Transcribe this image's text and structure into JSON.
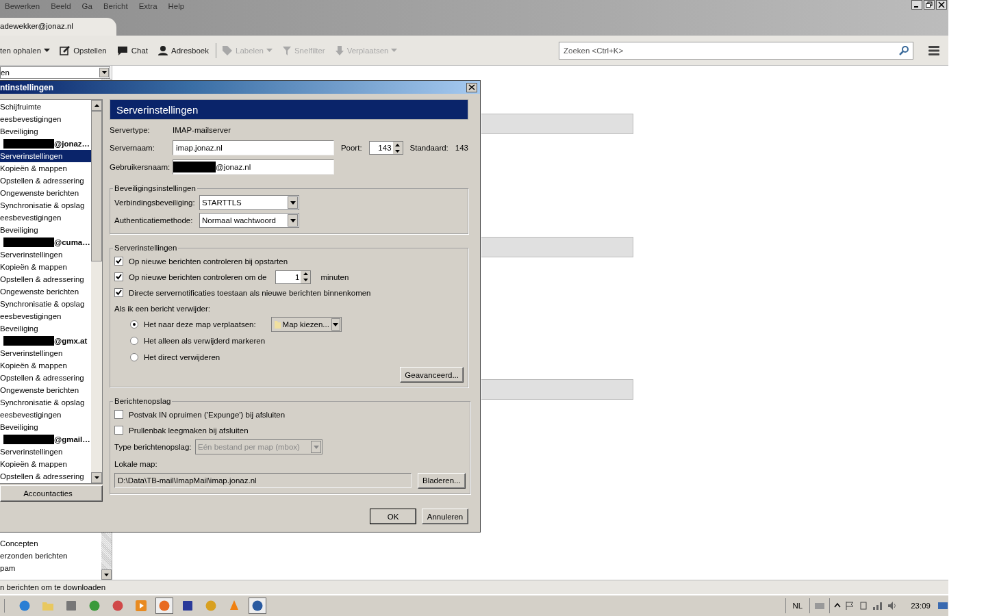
{
  "menu_bar": [
    "Bewerken",
    "Beeld",
    "Ga",
    "Bericht",
    "Extra",
    "Help"
  ],
  "tab": {
    "label": "adewekker@jonaz.nl",
    "selected": true
  },
  "toolbar": [
    {
      "label": "ten ophalen",
      "kind": "none",
      "dropdown": true,
      "disabled": false
    },
    {
      "label": "Opstellen",
      "kind": "pencil",
      "dropdown": false,
      "disabled": false
    },
    {
      "label": "Chat",
      "kind": "bubble",
      "dropdown": false,
      "disabled": false
    },
    {
      "label": "Adresboek",
      "kind": "person",
      "dropdown": false,
      "disabled": false
    },
    {
      "label": "Labelen",
      "kind": "tag",
      "dropdown": true,
      "disabled": true
    },
    {
      "label": "Snelfilter",
      "kind": "funnel",
      "dropdown": false,
      "disabled": true
    },
    {
      "label": "Verplaatsen",
      "kind": "arrow",
      "dropdown": true,
      "disabled": true
    }
  ],
  "search": {
    "placeholder": "Zoeken <Ctrl+K>"
  },
  "folder_pane": {
    "selector": "en",
    "folders": [
      "Concepten",
      "erzonden berichten",
      "pam"
    ]
  },
  "dialog": {
    "title": "ntinstellingen",
    "tree": [
      {
        "label": "Schijfruimte",
        "selected": false
      },
      {
        "label": "eesbevestigingen",
        "selected": false
      },
      {
        "label": "Beveiliging",
        "selected": false
      },
      {
        "label": "@jonaz…",
        "redacted": true,
        "selected": false,
        "children": [
          {
            "label": "Serverinstellingen",
            "selected": true
          },
          {
            "label": "Kopieën & mappen",
            "selected": false
          },
          {
            "label": "Opstellen & adressering",
            "selected": false
          },
          {
            "label": "Ongewenste berichten",
            "selected": false
          },
          {
            "label": "Synchronisatie & opslag",
            "selected": false
          },
          {
            "label": "eesbevestigingen",
            "selected": false
          },
          {
            "label": "Beveiliging",
            "selected": false
          }
        ]
      },
      {
        "label": "@cuma…",
        "redacted": true,
        "selected": false,
        "children": [
          {
            "label": "Serverinstellingen",
            "selected": false
          },
          {
            "label": "Kopieën & mappen",
            "selected": false
          },
          {
            "label": "Opstellen & adressering",
            "selected": false
          },
          {
            "label": "Ongewenste berichten",
            "selected": false
          },
          {
            "label": "Synchronisatie & opslag",
            "selected": false
          },
          {
            "label": "eesbevestigingen",
            "selected": false
          },
          {
            "label": "Beveiliging",
            "selected": false
          }
        ]
      },
      {
        "label": "@gmx.at",
        "redacted": true,
        "selected": false,
        "children": [
          {
            "label": "Serverinstellingen",
            "selected": false
          },
          {
            "label": "Kopieën & mappen",
            "selected": false
          },
          {
            "label": "Opstellen & adressering",
            "selected": false
          },
          {
            "label": "Ongewenste berichten",
            "selected": false
          },
          {
            "label": "Synchronisatie & opslag",
            "selected": false
          },
          {
            "label": "eesbevestigingen",
            "selected": false
          },
          {
            "label": "Beveiliging",
            "selected": false
          }
        ]
      },
      {
        "label": "@gmail…",
        "redacted": true,
        "selected": false,
        "children": [
          {
            "label": "Serverinstellingen",
            "selected": false
          },
          {
            "label": "Kopieën & mappen",
            "selected": false
          },
          {
            "label": "Opstellen & adressering",
            "selected": false
          }
        ]
      }
    ],
    "account_actions": "Accountacties",
    "header": "Serverinstellingen",
    "servertype": {
      "label": "Servertype:",
      "value": "IMAP-mailserver"
    },
    "servername": {
      "label": "Servernaam:",
      "value": "imap.jonaz.nl"
    },
    "port": {
      "label": "Poort:",
      "value": "143",
      "default_label": "Standaard:",
      "default_value": "143"
    },
    "username": {
      "label": "Gebruikersnaam:",
      "value": "@jonaz.nl",
      "redacted": true
    },
    "security": {
      "legend": "Beveiligingsinstellingen",
      "rows": [
        {
          "label": "Verbindingsbeveiliging:",
          "value": "STARTTLS"
        },
        {
          "label": "Authenticatiemethode:",
          "value": "Normaal wachtwoord"
        }
      ]
    },
    "server": {
      "legend": "Serverinstellingen",
      "checks": [
        {
          "label": "Op nieuwe berichten controleren bij opstarten",
          "checked": true
        },
        {
          "label": "Op nieuwe berichten controleren om de",
          "checked": true,
          "value": "1",
          "unit": "minuten"
        },
        {
          "label": "Directe servernotificaties toestaan als nieuwe berichten binnenkomen",
          "checked": true
        }
      ],
      "delete_label": "Als ik een bericht verwijder:",
      "radios": [
        {
          "label": "Het naar deze map verplaatsen:",
          "selected": true,
          "folder": "Map kiezen..."
        },
        {
          "label": "Het alleen als verwijderd markeren",
          "selected": false
        },
        {
          "label": "Het direct verwijderen",
          "selected": false
        }
      ],
      "advanced": "Geavanceerd..."
    },
    "storage": {
      "legend": "Berichtenopslag",
      "checks": [
        {
          "label": "Postvak IN opruimen ('Expunge') bij afsluiten",
          "checked": false
        },
        {
          "label": "Prullenbak leegmaken bij afsluiten",
          "checked": false
        }
      ],
      "type_label": "Type berichtenopslag:",
      "type_value": "Eén bestand per map (mbox)",
      "type_disabled": true,
      "local_label": "Lokale map:",
      "local_value": "D:\\Data\\TB-mail\\ImapMail\\imap.jonaz.nl",
      "browse": "Bladeren..."
    },
    "buttons": [
      "OK",
      "Annuleren"
    ]
  },
  "status_bar": "n berichten om te downloaden",
  "taskbar": {
    "language": "NL",
    "clock": "23:09"
  }
}
